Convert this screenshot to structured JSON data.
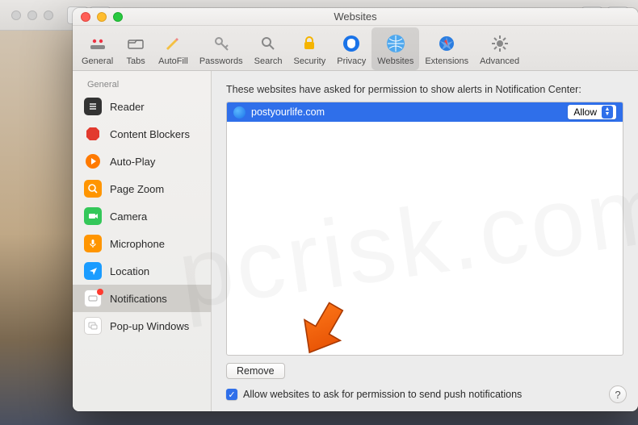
{
  "window": {
    "title": "Websites"
  },
  "toolbar": {
    "items": [
      {
        "label": "General"
      },
      {
        "label": "Tabs"
      },
      {
        "label": "AutoFill"
      },
      {
        "label": "Passwords"
      },
      {
        "label": "Search"
      },
      {
        "label": "Security"
      },
      {
        "label": "Privacy"
      },
      {
        "label": "Websites"
      },
      {
        "label": "Extensions"
      },
      {
        "label": "Advanced"
      }
    ]
  },
  "sidebar": {
    "section": "General",
    "items": [
      {
        "label": "Reader"
      },
      {
        "label": "Content Blockers"
      },
      {
        "label": "Auto-Play"
      },
      {
        "label": "Page Zoom"
      },
      {
        "label": "Camera"
      },
      {
        "label": "Microphone"
      },
      {
        "label": "Location"
      },
      {
        "label": "Notifications"
      },
      {
        "label": "Pop-up Windows"
      }
    ]
  },
  "main": {
    "heading": "These websites have asked for permission to show alerts in Notification Center:",
    "rows": [
      {
        "domain": "postyourlife.com",
        "permission": "Allow"
      }
    ],
    "remove_label": "Remove",
    "checkbox_label": "Allow websites to ask for permission to send push notifications",
    "help": "?"
  }
}
